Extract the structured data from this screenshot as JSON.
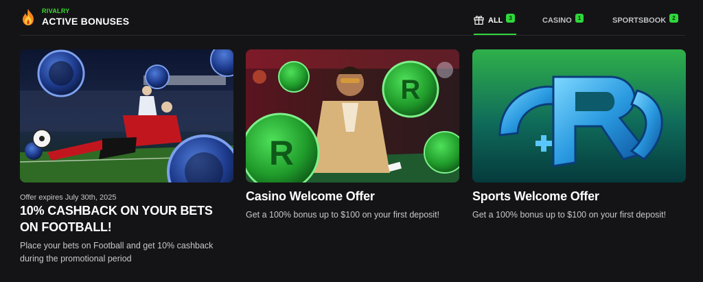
{
  "brand": {
    "kicker": "RIVALRY",
    "title": "ACTIVE BONUSES",
    "icon": "flame-icon"
  },
  "tabs": [
    {
      "label": "ALL",
      "count": "3",
      "icon": "gift-icon",
      "active": true
    },
    {
      "label": "CASINO",
      "count": "1",
      "active": false
    },
    {
      "label": "SPORTSBOOK",
      "count": "2",
      "active": false
    }
  ],
  "cards": [
    {
      "expiry": "Offer expires July 30th, 2025",
      "title": "10% CASHBACK ON YOUR BETS ON FOOTBALL!",
      "description": "Place your bets on Football and get 10% cashback during the promotional period",
      "image": "football-promo-image"
    },
    {
      "title": "Casino Welcome Offer",
      "description": "Get a 100% bonus up to $100 on your first deposit!",
      "image": "casino-promo-image"
    },
    {
      "title": "Sports Welcome Offer",
      "description": "Get a 100% bonus up to $100 on your first deposit!",
      "image": "sports-promo-image"
    }
  ],
  "colors": {
    "background": "#141416",
    "accent": "#2fd83a",
    "text_muted": "#c8c8cc"
  }
}
